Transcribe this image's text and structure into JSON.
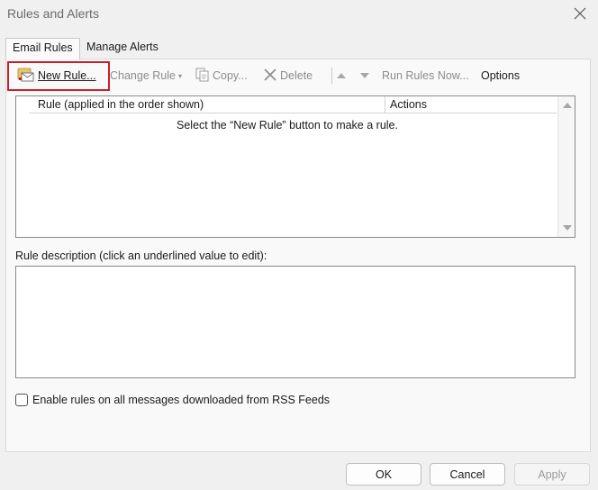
{
  "window": {
    "title": "Rules and Alerts"
  },
  "tabs": [
    {
      "label": "Email Rules",
      "active": true
    },
    {
      "label": "Manage Alerts",
      "active": false
    }
  ],
  "toolbar": {
    "new_rule": {
      "label": "New Rule...",
      "icon": "new-rule-icon",
      "enabled": true,
      "highlighted": true
    },
    "change_rule": {
      "label": "Change Rule",
      "icon": "chevron-down-icon",
      "enabled": false
    },
    "copy": {
      "label": "Copy...",
      "icon": "copy-icon",
      "enabled": false
    },
    "delete": {
      "label": "Delete",
      "icon": "delete-x-icon",
      "enabled": false
    },
    "move_up": {
      "icon": "arrow-up-icon",
      "enabled": false
    },
    "move_down": {
      "icon": "arrow-down-icon",
      "enabled": false
    },
    "run_rules": {
      "label": "Run Rules Now...",
      "enabled": false
    },
    "options": {
      "label": "Options",
      "enabled": true
    }
  },
  "rules_table": {
    "columns": [
      "Rule (applied in the order shown)",
      "Actions"
    ],
    "rows": [],
    "empty_message": "Select the “New Rule” button to make a rule."
  },
  "description": {
    "label": "Rule description (click an underlined value to edit):",
    "value": ""
  },
  "rss_checkbox": {
    "label": "Enable rules on all messages downloaded from RSS Feeds",
    "checked": false
  },
  "buttons": {
    "ok": "OK",
    "cancel": "Cancel",
    "apply": "Apply"
  },
  "colors": {
    "highlight_border": "#c8202a",
    "disabled_text": "#8c8c8c"
  }
}
